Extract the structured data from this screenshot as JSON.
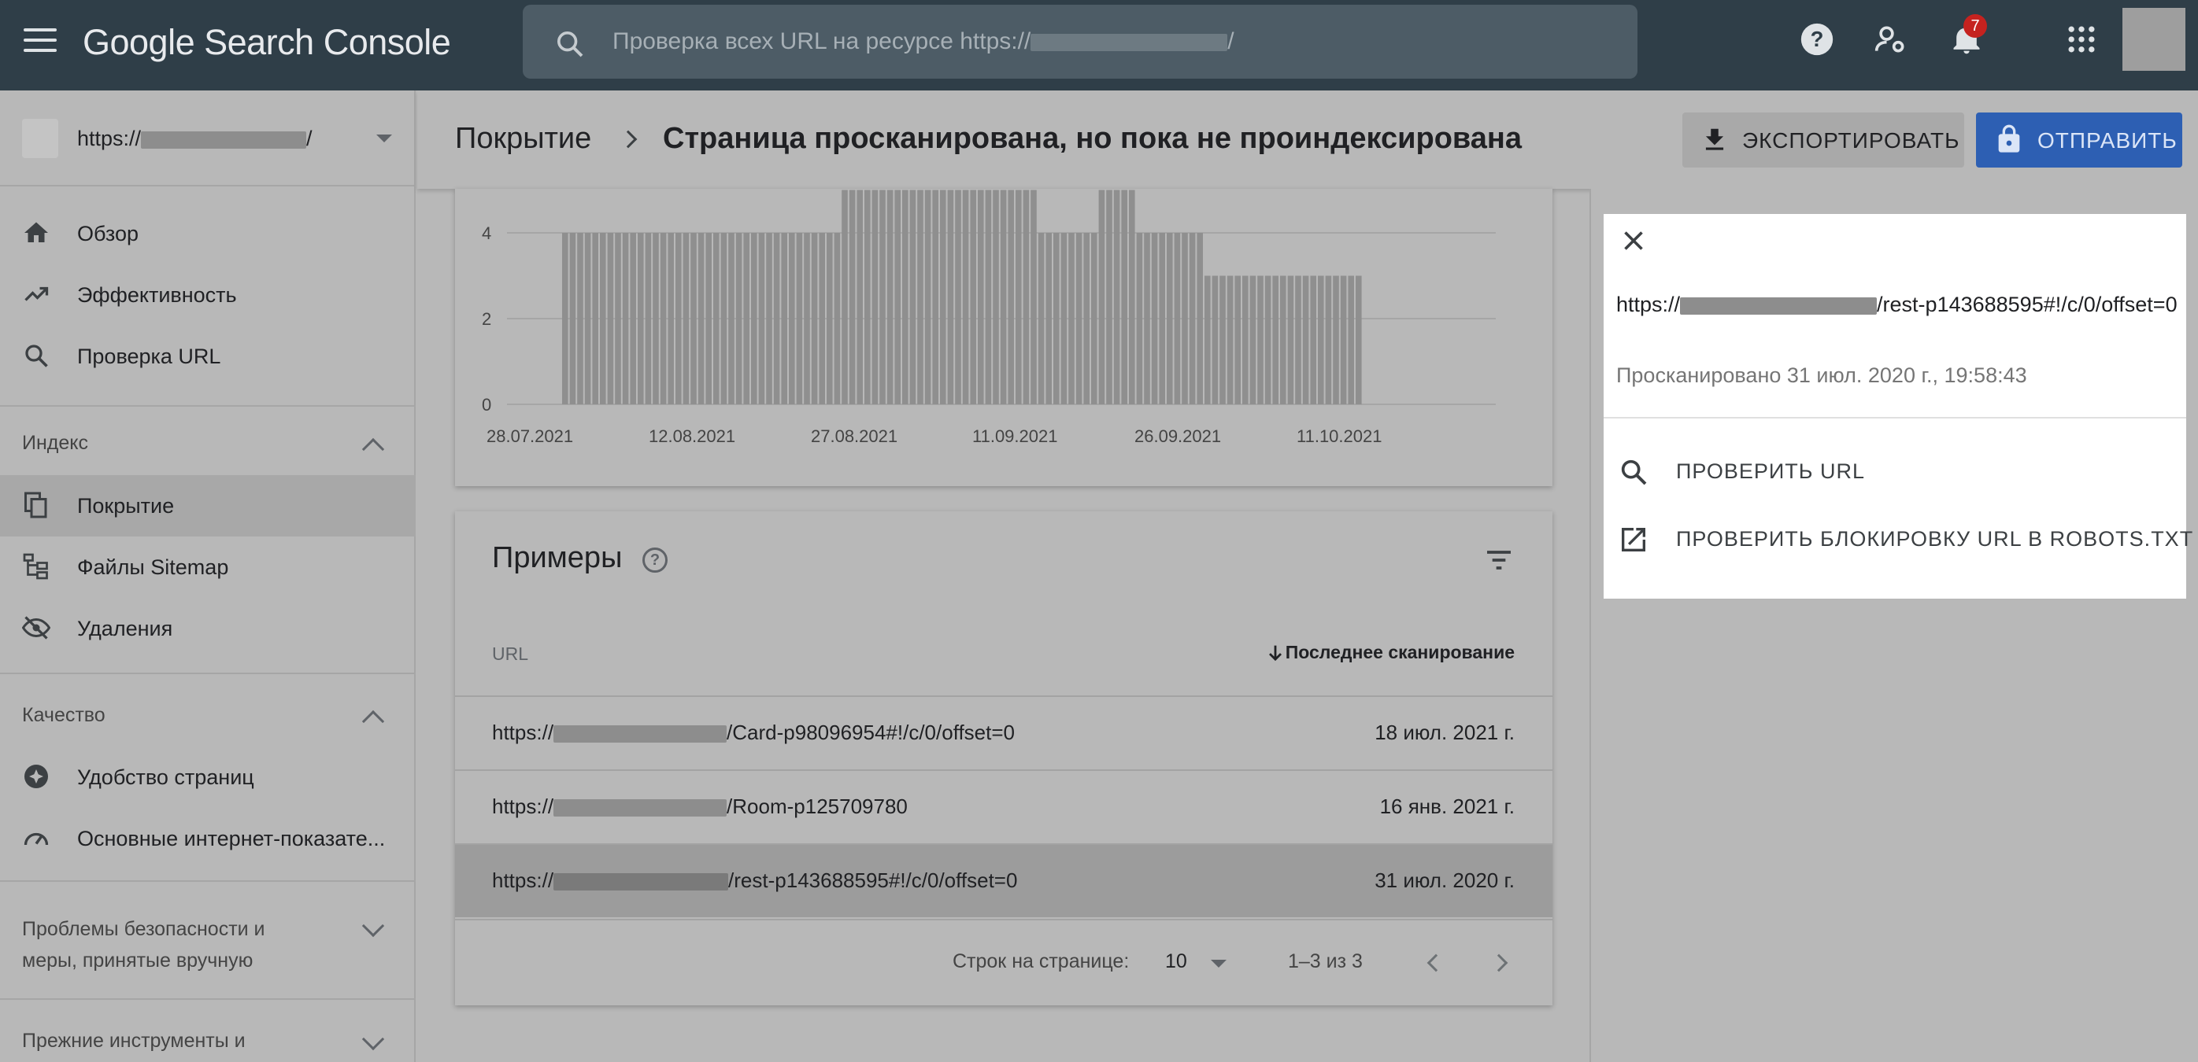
{
  "app": {
    "title": "Google Search Console",
    "search_placeholder_prefix": "Проверка всех URL на ресурсе https://",
    "search_placeholder_suffix": "/",
    "notification_count": "7"
  },
  "property": {
    "prefix": "https://",
    "suffix": "/"
  },
  "nav": {
    "overview": "Обзор",
    "performance": "Эффективность",
    "url_inspection": "Проверка URL",
    "index_header": "Индекс",
    "coverage": "Покрытие",
    "sitemaps": "Файлы Sitemap",
    "removals": "Удаления",
    "quality_header": "Качество",
    "page_experience": "Удобство страниц",
    "web_vitals": "Основные интернет-показате...",
    "security_header_1": "Проблемы безопасности и",
    "security_header_2": "меры, принятые вручную",
    "legacy_header": "Прежние инструменты и"
  },
  "header": {
    "crumb1": "Покрытие",
    "crumb2": "Страница просканирована, но пока не проиндексирована",
    "export_label": "ЭКСПОРТИРОВАТЬ",
    "send_label": "ОТПРАВИТЬ"
  },
  "chart_data": {
    "type": "bar",
    "y_ticks": [
      "0",
      "2",
      "4"
    ],
    "x_ticks": [
      "28.07.2021",
      "12.08.2021",
      "27.08.2021",
      "11.09.2021",
      "26.09.2021",
      "11.10.2021"
    ],
    "values": [
      4,
      4,
      4,
      4,
      4,
      4,
      4,
      4,
      4,
      4,
      4,
      4,
      4,
      4,
      4,
      4,
      4,
      4,
      4,
      4,
      4,
      4,
      4,
      4,
      4,
      4,
      4,
      4,
      4,
      4,
      4,
      4,
      4,
      4,
      4,
      4,
      4,
      4,
      4,
      4,
      4,
      4,
      4,
      4,
      4,
      4,
      4,
      4,
      4,
      4,
      4,
      4,
      4,
      4,
      4,
      4,
      4,
      4,
      4,
      4,
      4,
      4,
      4,
      4,
      4,
      4,
      4,
      4,
      4,
      4,
      4,
      4,
      4,
      4,
      4,
      4,
      4,
      4,
      4,
      4,
      4,
      4,
      4,
      4,
      4,
      3,
      3,
      3,
      3,
      3,
      3,
      3,
      3,
      3,
      3,
      3,
      3,
      3,
      3,
      3,
      3,
      3,
      3,
      3,
      3,
      3
    ],
    "upper_values": [
      0,
      0,
      0,
      0,
      0,
      0,
      0,
      0,
      0,
      0,
      0,
      0,
      0,
      0,
      0,
      0,
      0,
      0,
      0,
      0,
      0,
      0,
      0,
      0,
      0,
      0,
      0,
      0,
      0,
      0,
      0,
      0,
      0,
      0,
      0,
      0,
      0,
      1,
      1,
      1,
      1,
      1,
      1,
      1,
      1,
      1,
      1,
      1,
      1,
      1,
      1,
      1,
      1,
      1,
      1,
      1,
      1,
      1,
      1,
      1,
      1,
      1,
      1,
      0,
      0,
      0,
      0,
      0,
      0,
      0,
      0,
      1,
      1,
      1,
      1,
      1,
      0,
      0,
      0,
      0,
      0,
      0,
      0,
      0,
      0,
      0,
      0,
      0,
      0,
      0,
      0,
      0,
      0,
      0,
      0,
      0,
      0,
      0,
      0,
      0,
      0,
      0,
      0,
      0,
      0,
      0
    ],
    "ylim": [
      0,
      5
    ]
  },
  "examples": {
    "title": "Примеры",
    "col_url": "URL",
    "col_last_crawl": "Последнее сканирование",
    "rows": [
      {
        "url_prefix": "https://",
        "url_suffix": "/Card-p98096954#!/c/0/offset=0",
        "date": "18 июл. 2021 г."
      },
      {
        "url_prefix": "https://",
        "url_suffix": "/Room-p125709780",
        "date": "16 янв. 2021 г."
      },
      {
        "url_prefix": "https://",
        "url_suffix": "/rest-p143688595#!/c/0/offset=0",
        "date": "31 июл. 2020 г."
      }
    ],
    "rows_per_page_label": "Строк на странице:",
    "rows_per_page": "10",
    "range": "1–3 из 3"
  },
  "panel": {
    "url_prefix": "https://",
    "url_suffix": "/rest-p143688595#!/c/0/offset=0",
    "crawled": "Просканировано 31 июл. 2020 г., 19:58:43",
    "action_inspect": "ПРОВЕРИТЬ URL",
    "action_robots": "ПРОВЕРИТЬ БЛОКИРОВКУ URL В ROBOTS.TXT"
  }
}
